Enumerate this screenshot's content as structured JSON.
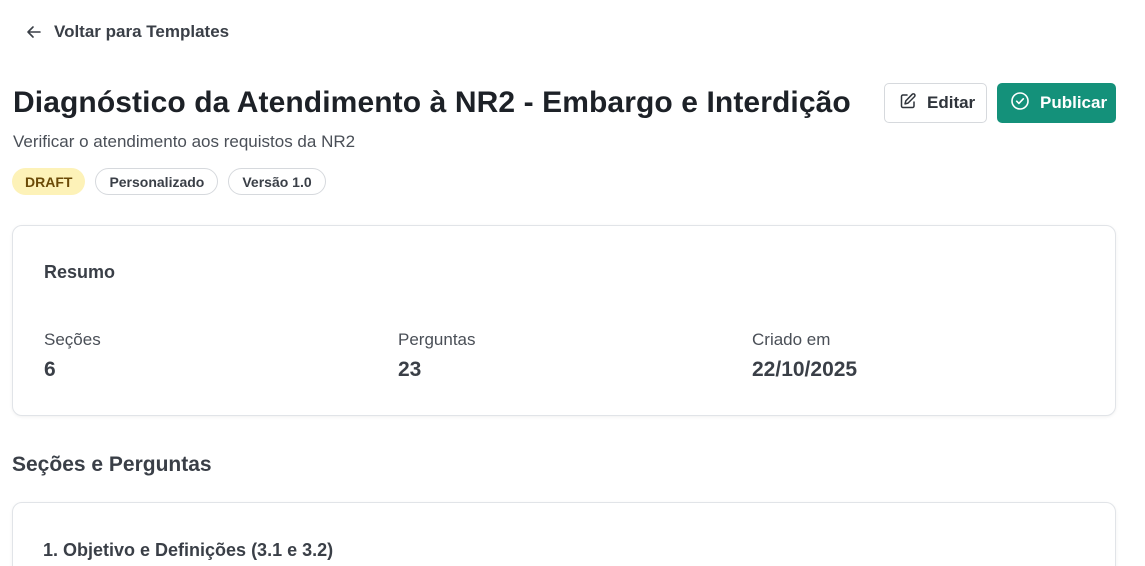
{
  "nav": {
    "back_label": "Voltar para Templates",
    "back_icon": "arrow-left-icon"
  },
  "header": {
    "title": "Diagnóstico da Atendimento à NR2 - Embargo e Interdição",
    "subtitle": "Verificar o atendimento aos requistos da NR2",
    "edit_label": "Editar",
    "edit_icon": "pencil-square-icon",
    "publish_label": "Publicar",
    "publish_icon": "check-circle-icon",
    "badges": [
      "DRAFT",
      "Personalizado",
      "Versão 1.0"
    ]
  },
  "summary": {
    "title": "Resumo",
    "stats": [
      {
        "label": "Seções",
        "value": "6"
      },
      {
        "label": "Perguntas",
        "value": "23"
      },
      {
        "label": "Criado em",
        "value": "22/10/2025"
      }
    ]
  },
  "sections": {
    "heading": "Seções e Perguntas",
    "items": [
      {
        "title": "1. Objetivo e Definições (3.1 e 3.2)"
      }
    ]
  },
  "colors": {
    "primary": "#14917a",
    "draft_badge_bg": "#fdf2b8",
    "draft_badge_text": "#6b4a07",
    "border": "#e1e4e8"
  }
}
